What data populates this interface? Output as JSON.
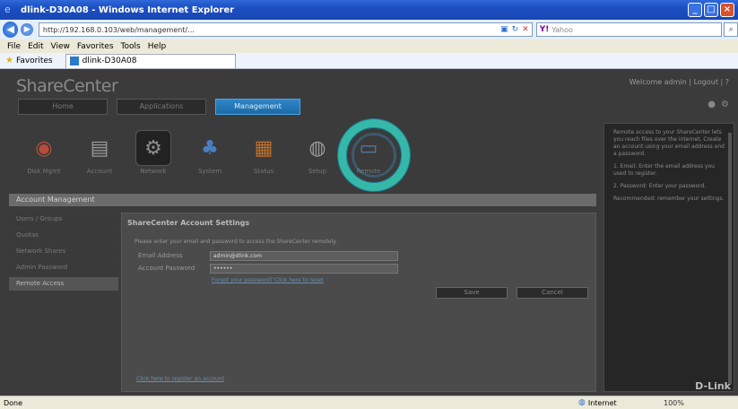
{
  "window": {
    "title": "dlink-D30A08 - Windows Internet Explorer"
  },
  "addressbar": {
    "url": "http://192.168.0.103/web/management/...",
    "search_placeholder": "Yahoo"
  },
  "menubar": [
    "File",
    "Edit",
    "View",
    "Favorites",
    "Tools",
    "Help"
  ],
  "favorites": {
    "label": "Favorites",
    "tab_title": "dlink-D30A08"
  },
  "app": {
    "brand": "ShareCenter",
    "user_links": "Welcome admin | Logout | ?",
    "nav_tabs": [
      "Home",
      "Applications",
      "Management"
    ],
    "apps": [
      "Disk Mgmt",
      "Account",
      "Network",
      "System",
      "Status",
      "Setup",
      "Remote"
    ],
    "section_header": "Account Management",
    "left_nav": [
      "Users / Groups",
      "Quotas",
      "Network Shares",
      "Admin Password",
      "Remote Access"
    ],
    "panel": {
      "title": "ShareCenter Account Settings",
      "description": "Please enter your email and password to access the ShareCenter remotely.",
      "email_label": "Email Address",
      "email_value": "admin@dlink.com",
      "password_label": "Account Password",
      "password_value": "••••••",
      "forgot_link": "Forgot your password? Click here to reset",
      "apply_label": "Save",
      "cancel_label": "Cancel",
      "bottom_link": "Click here to register an account"
    },
    "help_text": [
      "Remote access to your ShareCenter lets you reach files over the internet. Create an account using your email address and a password.",
      "1. Email: Enter the email address you used to register.",
      "2. Password: Enter your password.",
      "Recommended: remember your settings."
    ],
    "brand_logo": "D-Link"
  },
  "status": {
    "text": "Done",
    "zone": "Internet",
    "zoom": "100%"
  },
  "colors": {
    "accent": "#36b8a8",
    "active_tab": "#2f86c8"
  }
}
